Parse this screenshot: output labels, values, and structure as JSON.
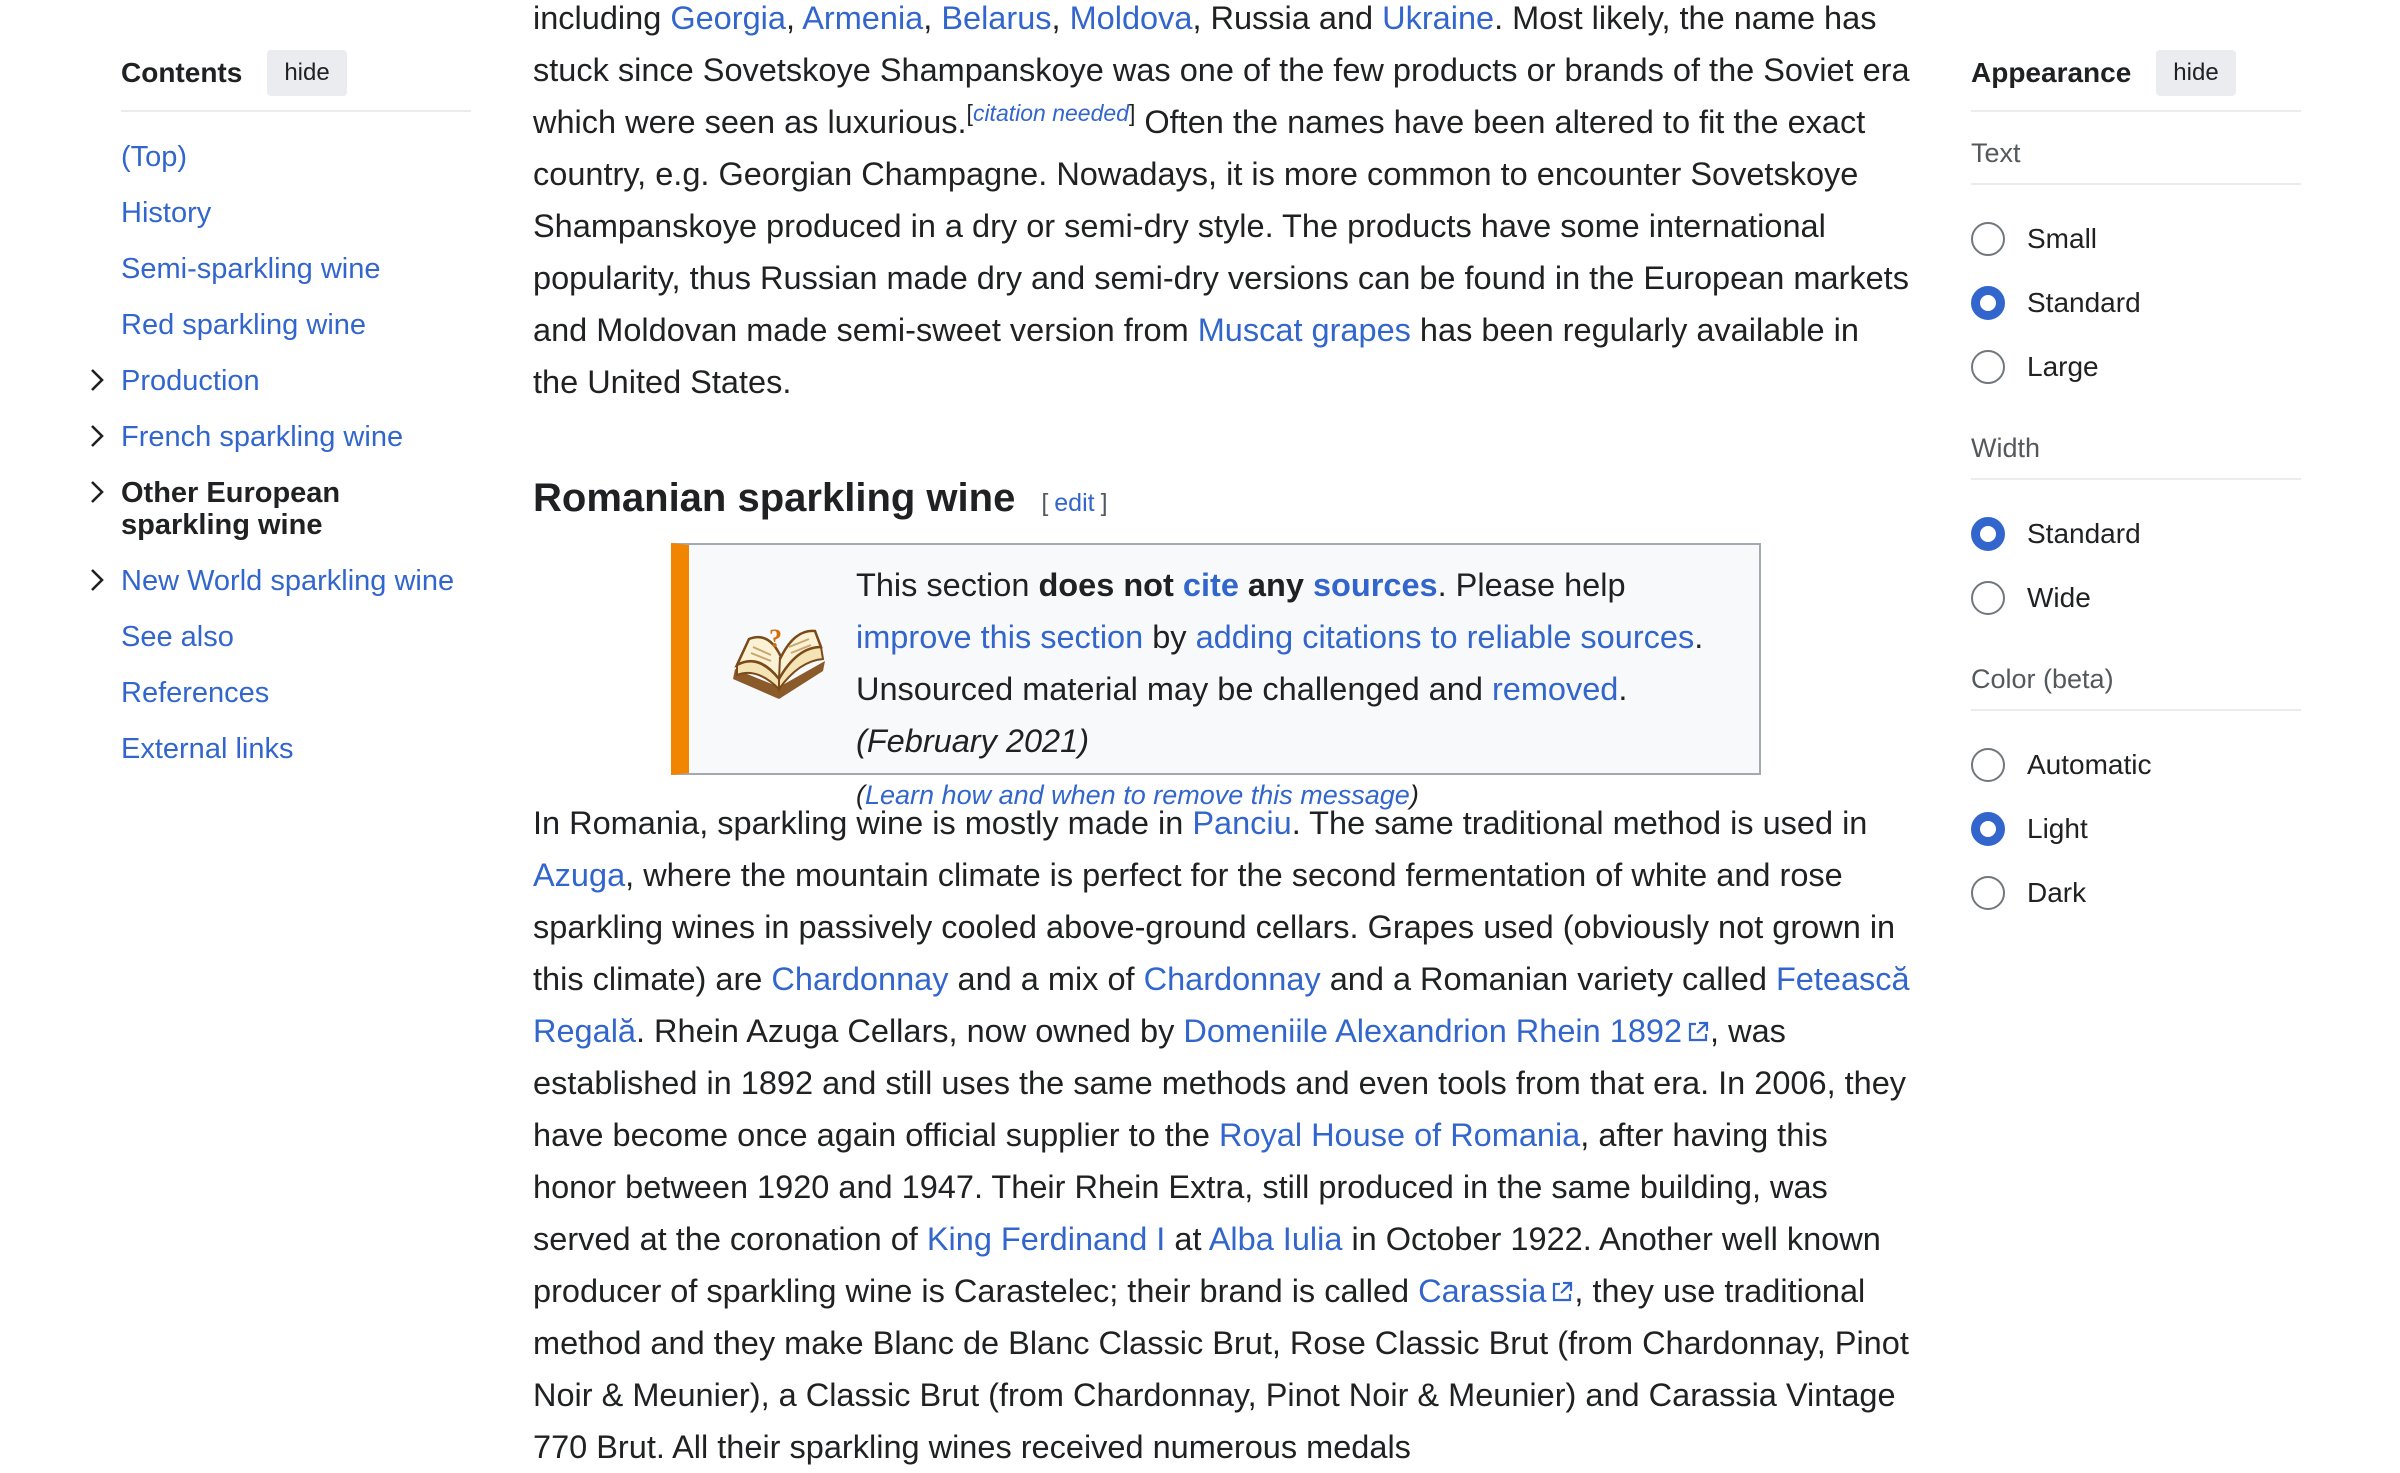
{
  "toc": {
    "title": "Contents",
    "hide_label": "hide",
    "items": [
      {
        "label": "(Top)",
        "expandable": false
      },
      {
        "label": "History",
        "expandable": false
      },
      {
        "label": "Semi-sparkling wine",
        "expandable": false
      },
      {
        "label": "Red sparkling wine",
        "expandable": false
      },
      {
        "label": "Production",
        "expandable": true
      },
      {
        "label": "French sparkling wine",
        "expandable": true
      },
      {
        "label": "Other European sparkling wine",
        "expandable": true,
        "active": true
      },
      {
        "label": "New World sparkling wine",
        "expandable": true
      },
      {
        "label": "See also",
        "expandable": false
      },
      {
        "label": "References",
        "expandable": false
      },
      {
        "label": "External links",
        "expandable": false
      }
    ]
  },
  "intro": {
    "t1": "including ",
    "georgia": "Georgia",
    "c1": ", ",
    "armenia": "Armenia",
    "c2": ", ",
    "belarus": "Belarus",
    "c3": ", ",
    "moldova": "Moldova",
    "t2": ", Russia and ",
    "ukraine": "Ukraine",
    "t3": ". Most likely, the name has stuck since Sovetskoye Shampanskoye was one of the few products or brands of the Soviet era which were seen as luxurious.",
    "cite_open": "[",
    "citation_needed": "citation needed",
    "cite_close": "]",
    "t4": " Often the names have been altered to fit the exact country, e.g. Georgian Champagne. Nowadays, it is more common to encounter Sovetskoye Shampanskoye produced in a dry or semi-dry style. The products have some international popularity, thus Russian made dry and semi-dry versions can be found in the European markets and Moldovan made semi-sweet version from ",
    "muscat": "Muscat grapes",
    "t5": " has been regularly available in the United States."
  },
  "section": {
    "heading": "Romanian sparkling wine",
    "edit_open": "[",
    "edit_label": "edit",
    "edit_close": "]"
  },
  "ambox": {
    "a1": "This section ",
    "b1": "does not ",
    "cite": "cite",
    "b2": " any ",
    "sources": "sources",
    "a2": ". Please help ",
    "improve": "improve this section",
    "a3": " by ",
    "adding": "adding citations to reliable sources",
    "a4": ". Unsourced material may be challenged and ",
    "removed": "removed",
    "a5": ". ",
    "date": "(February 2021)",
    "learn_open": "(",
    "learn": "Learn how and when to remove this message",
    "learn_close": ")"
  },
  "romania": {
    "t1": "In Romania, sparkling wine is mostly made in ",
    "panciu": "Panciu",
    "t2": ". The same traditional method is used in ",
    "azuga": "Azuga",
    "t3": ", where the mountain climate is perfect for the second fermentation of white and rose sparkling wines in passively cooled above-ground cellars. Grapes used (obviously not grown in this climate) are ",
    "chardonnay1": "Chardonnay",
    "t4": " and a mix of ",
    "chardonnay2": "Chardonnay",
    "t5": " and a Romanian variety called ",
    "feteasca": "Fetească Regală",
    "t6": ". Rhein Azuga Cellars, now owned by ",
    "domeniile": "Domeniile Alexandrion Rhein 1892",
    "t7": ", was established in 1892 and still uses the same methods and even tools from that era. In 2006, they have become once again official supplier to the ",
    "royal": "Royal House of Romania",
    "t8": ", after having this honor between 1920 and 1947. Their Rhein Extra, still produced in the same building, was served at the coronation of ",
    "king": "King Ferdinand I",
    "t9": " at ",
    "alba": "Alba Iulia",
    "t10": " in October 1922. Another well known producer of sparkling wine is Carastelec; their brand is called ",
    "carassia": "Carassia",
    "t11": ", they use traditional method and they make Blanc de Blanc Classic Brut, Rose Classic Brut (from Chardonnay, Pinot Noir & Meunier), a Classic Brut (from Chardonnay, Pinot Noir & Meunier) and Carassia Vintage 770 Brut. All their sparkling wines received numerous medals"
  },
  "appearance": {
    "title": "Appearance",
    "hide_label": "hide",
    "text_heading": "Text",
    "text_options": [
      {
        "label": "Small",
        "selected": false
      },
      {
        "label": "Standard",
        "selected": true
      },
      {
        "label": "Large",
        "selected": false
      }
    ],
    "width_heading": "Width",
    "width_options": [
      {
        "label": "Standard",
        "selected": true
      },
      {
        "label": "Wide",
        "selected": false
      }
    ],
    "color_heading": "Color (beta)",
    "color_options": [
      {
        "label": "Automatic",
        "selected": false
      },
      {
        "label": "Light",
        "selected": true
      },
      {
        "label": "Dark",
        "selected": false
      }
    ]
  },
  "colors": {
    "link": "#3366cc",
    "text": "#202122",
    "ambox_stripe": "#f28500",
    "radio_selected": "#3366cc"
  }
}
